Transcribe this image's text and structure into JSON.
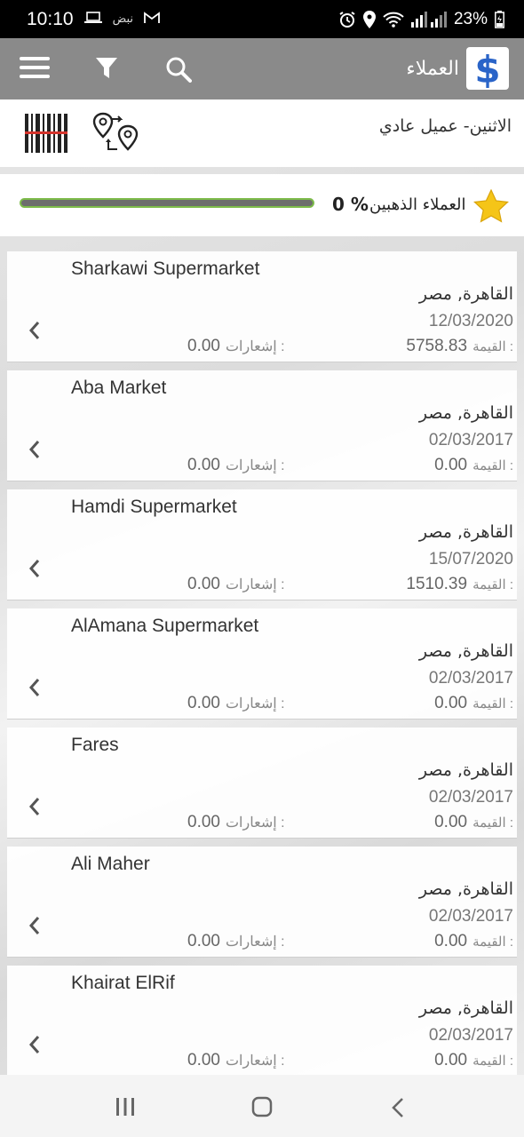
{
  "status_bar": {
    "time": "10:10",
    "extra_label": "نبض",
    "battery": "23%",
    "icons": [
      "laptop-icon",
      "gmail-icon",
      "alarm-icon",
      "location-icon",
      "wifi-icon",
      "signal-icon",
      "battery-icon"
    ]
  },
  "app_bar": {
    "title": "العملاء",
    "logo_glyph": "$",
    "icons": [
      "menu-icon",
      "filter-icon",
      "search-icon"
    ]
  },
  "sub_header": {
    "text": "الاثنين- عميل عادي",
    "icons": [
      "barcode-icon",
      "route-icon"
    ]
  },
  "gold_customers": {
    "label": "العملاء الذهبين",
    "percent_text": "0 %",
    "progress": 0,
    "icon": "star-icon"
  },
  "customers": [
    {
      "name": "Sharkawi Supermarket",
      "city": "القاهرة, مصر",
      "date": "12/03/2020",
      "value_label": "القيمة :",
      "value": "5758.83",
      "notif_label": "إشعارات :",
      "notif": "0.00"
    },
    {
      "name": "Aba Market",
      "city": "القاهرة, مصر",
      "date": "02/03/2017",
      "value_label": "القيمة :",
      "value": "0.00",
      "notif_label": "إشعارات :",
      "notif": "0.00"
    },
    {
      "name": "Hamdi Supermarket",
      "city": "القاهرة, مصر",
      "date": "15/07/2020",
      "value_label": "القيمة :",
      "value": "1510.39",
      "notif_label": "إشعارات :",
      "notif": "0.00"
    },
    {
      "name": "AlAmana Supermarket",
      "city": "القاهرة, مصر",
      "date": "02/03/2017",
      "value_label": "القيمة :",
      "value": "0.00",
      "notif_label": "إشعارات :",
      "notif": "0.00"
    },
    {
      "name": "Fares",
      "city": "القاهرة, مصر",
      "date": "02/03/2017",
      "value_label": "القيمة :",
      "value": "0.00",
      "notif_label": "إشعارات :",
      "notif": "0.00"
    },
    {
      "name": "Ali Maher",
      "city": "القاهرة, مصر",
      "date": "02/03/2017",
      "value_label": "القيمة :",
      "value": "0.00",
      "notif_label": "إشعارات :",
      "notif": "0.00"
    },
    {
      "name": "Khairat ElRif",
      "city": "القاهرة, مصر",
      "date": "02/03/2017",
      "value_label": "القيمة :",
      "value": "0.00",
      "notif_label": "إشعارات :",
      "notif": "0.00"
    }
  ],
  "colors": {
    "app_bar": "#8a8a8a",
    "progress_accent": "#7dbb4a",
    "star": "#f5c518",
    "logo_blue": "#2a64c8"
  },
  "nav_bar": {
    "icons": [
      "recent-apps-icon",
      "home-icon",
      "back-icon"
    ]
  }
}
